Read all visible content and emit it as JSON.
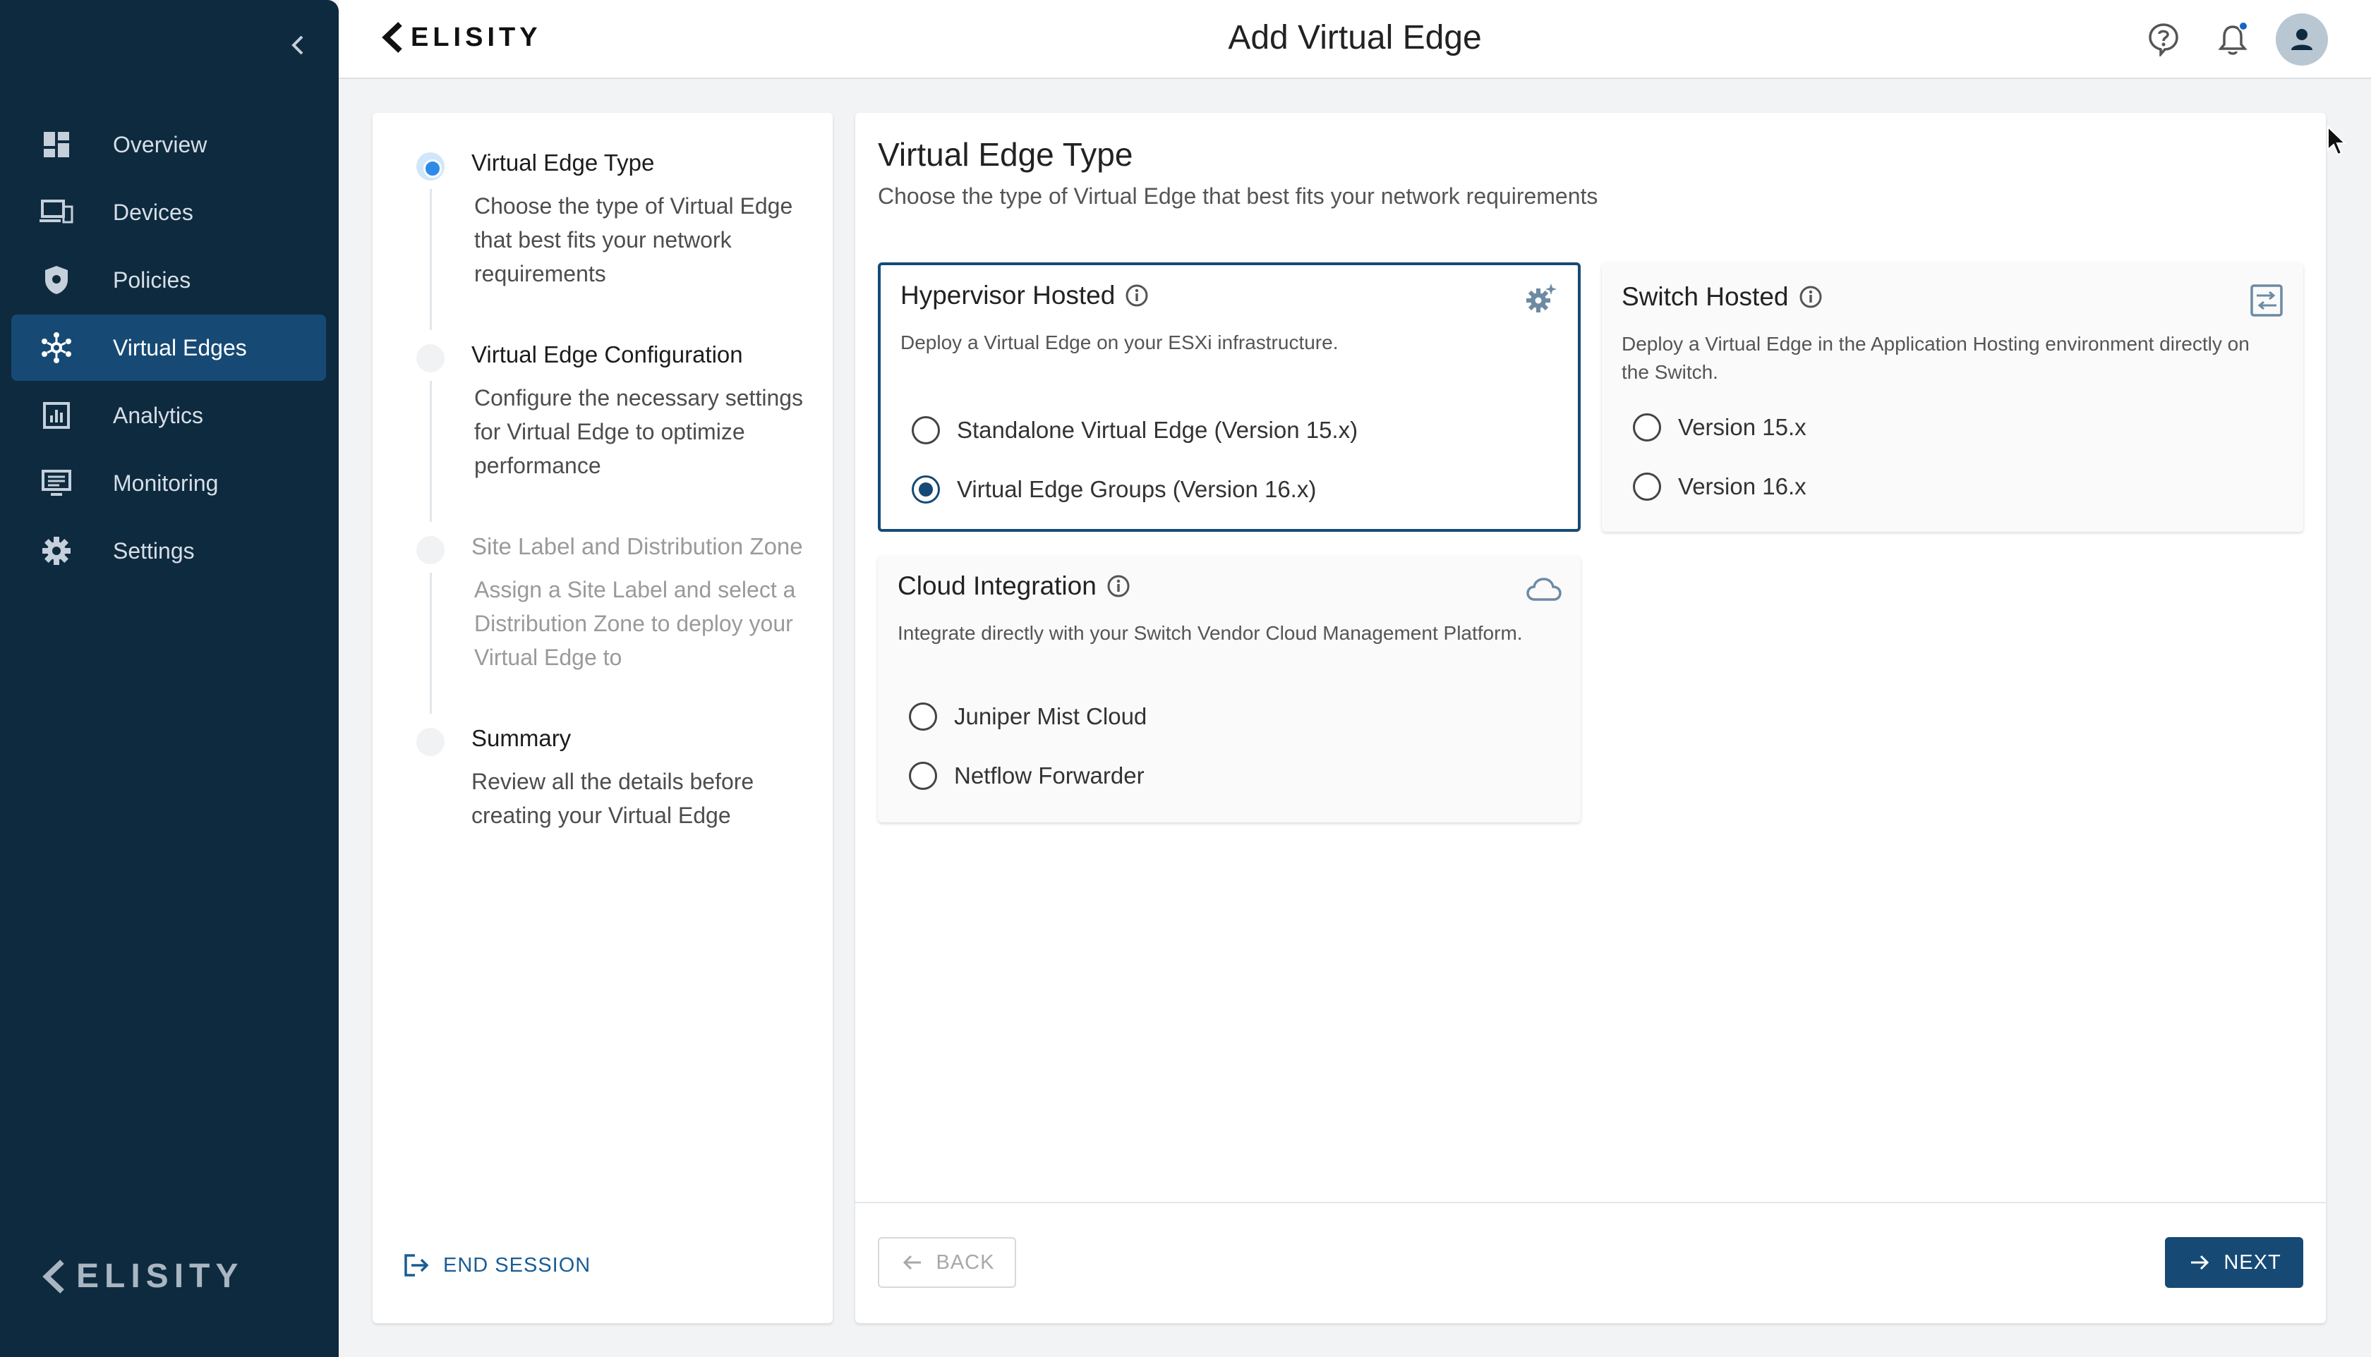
{
  "app": {
    "brand": "ELISITY",
    "page_title": "Add Virtual Edge"
  },
  "sidebar": {
    "items": [
      {
        "label": "Overview",
        "icon": "dashboard-icon",
        "active": false
      },
      {
        "label": "Devices",
        "icon": "devices-icon",
        "active": false
      },
      {
        "label": "Policies",
        "icon": "shield-icon",
        "active": false
      },
      {
        "label": "Virtual Edges",
        "icon": "network-hub-icon",
        "active": true
      },
      {
        "label": "Analytics",
        "icon": "bar-chart-icon",
        "active": false
      },
      {
        "label": "Monitoring",
        "icon": "monitor-list-icon",
        "active": false
      },
      {
        "label": "Settings",
        "icon": "gear-icon",
        "active": false
      }
    ],
    "footer_brand": "ELISITY"
  },
  "header": {
    "icons": [
      "help-icon",
      "bell-icon",
      "user-avatar-icon"
    ]
  },
  "stepper": {
    "steps": [
      {
        "title": "Virtual Edge Type",
        "description": "Choose the type of Virtual Edge that best fits your network requirements",
        "state": "current"
      },
      {
        "title": "Virtual Edge Configuration",
        "description": "Configure the necessary settings for Virtual Edge to optimize performance",
        "state": "pending"
      },
      {
        "title": "Site Label and Distribution Zone",
        "description": "Assign a Site Label and select a Distribution Zone to deploy your Virtual Edge to",
        "state": "disabled"
      },
      {
        "title": "Summary",
        "description": "Review all the details before creating your Virtual Edge",
        "state": "pending"
      }
    ],
    "end_session_label": "END SESSION"
  },
  "main": {
    "title": "Virtual Edge Type",
    "subtitle": "Choose the type of Virtual Edge that best fits your network requirements",
    "cards": {
      "hypervisor": {
        "title": "Hypervisor Hosted",
        "description": "Deploy a Virtual Edge on your ESXi infrastructure.",
        "icon": "gear-sparkle-icon",
        "selected": true,
        "options": [
          {
            "label": "Standalone Virtual Edge (Version 15.x)",
            "checked": false
          },
          {
            "label": "Virtual Edge Groups (Version 16.x)",
            "checked": true
          }
        ]
      },
      "switch": {
        "title": "Switch Hosted",
        "description": "Deploy a Virtual Edge in the Application Hosting environment directly on the Switch.",
        "icon": "switch-icon",
        "selected": false,
        "options": [
          {
            "label": "Version 15.x",
            "checked": false
          },
          {
            "label": "Version 16.x",
            "checked": false
          }
        ]
      },
      "cloud": {
        "title": "Cloud Integration",
        "description": "Integrate directly with your Switch Vendor Cloud Management Platform.",
        "icon": "cloud-icon",
        "selected": false,
        "options": [
          {
            "label": "Juniper Mist Cloud",
            "checked": false
          },
          {
            "label": "Netflow Forwarder",
            "checked": false
          }
        ]
      }
    },
    "back_label": "BACK",
    "next_label": "NEXT"
  },
  "colors": {
    "sidebar_bg": "#0e2a3f",
    "active_nav": "#164a75",
    "accent": "#164a75",
    "link": "#1a5d94",
    "current_step": "#2e8be8"
  }
}
